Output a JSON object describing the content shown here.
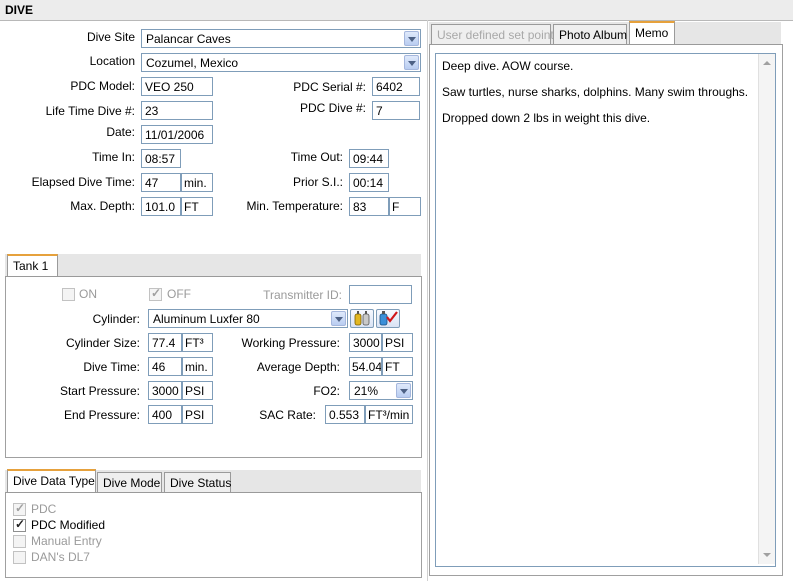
{
  "header": {
    "title": "DIVE"
  },
  "dive": {
    "dive_site": {
      "label": "Dive Site",
      "value": "Palancar Caves"
    },
    "location": {
      "label": "Location",
      "value": "Cozumel, Mexico"
    },
    "pdc_model": {
      "label": "PDC Model:",
      "value": "VEO 250"
    },
    "pdc_serial": {
      "label": "PDC Serial #:",
      "value": "6402"
    },
    "life_time_dive": {
      "label": "Life Time Dive #:",
      "value": "23"
    },
    "pdc_dive": {
      "label": "PDC Dive #:",
      "value": "7"
    },
    "date": {
      "label": "Date:",
      "value": "11/01/2006"
    },
    "time_in": {
      "label": "Time In:",
      "value": "08:57"
    },
    "time_out": {
      "label": "Time Out:",
      "value": "09:44"
    },
    "elapsed": {
      "label": "Elapsed Dive Time:",
      "value": "47",
      "unit": "min."
    },
    "prior_si": {
      "label": "Prior S.I.:",
      "value": "00:14"
    },
    "max_depth": {
      "label": "Max. Depth:",
      "value": "101.0",
      "unit": "FT"
    },
    "min_temp": {
      "label": "Min. Temperature:",
      "value": "83",
      "unit": "F"
    }
  },
  "tank": {
    "tab_label": "Tank 1",
    "on_label": "ON",
    "off_label": "OFF",
    "transmitter": {
      "label": "Transmitter ID:",
      "value": ""
    },
    "cylinder": {
      "label": "Cylinder:",
      "value": "Aluminum Luxfer 80"
    },
    "cylinder_size": {
      "label": "Cylinder Size:",
      "value": "77.4",
      "unit": "FT³"
    },
    "working_pressure": {
      "label": "Working Pressure:",
      "value": "3000",
      "unit": "PSI"
    },
    "dive_time": {
      "label": "Dive Time:",
      "value": "46",
      "unit": "min."
    },
    "average_depth": {
      "label": "Average Depth:",
      "value": "54.04",
      "unit": "FT"
    },
    "start_pressure": {
      "label": "Start Pressure:",
      "value": "3000",
      "unit": "PSI"
    },
    "fo2": {
      "label": "FO2:",
      "value": "21%"
    },
    "end_pressure": {
      "label": "End Pressure:",
      "value": "400",
      "unit": "PSI"
    },
    "sac_rate": {
      "label": "SAC Rate:",
      "value": "0.553",
      "unit": "FT³/min"
    }
  },
  "bottom_tabs": [
    "Dive Data Type",
    "Dive Mode",
    "Dive Status"
  ],
  "data_type": [
    {
      "label": "PDC",
      "checked": true,
      "enabled": false
    },
    {
      "label": "PDC Modified",
      "checked": true,
      "enabled": true
    },
    {
      "label": "Manual Entry",
      "checked": false,
      "enabled": false
    },
    {
      "label": "DAN's DL7",
      "checked": false,
      "enabled": false
    }
  ],
  "right_tabs": [
    "User defined set points",
    "Photo Album",
    "Memo"
  ],
  "memo_lines": [
    "Deep dive. AOW course.",
    "Saw turtles, nurse sharks, dolphins. Many swim throughs.",
    "Dropped down 2 lbs in weight this dive."
  ]
}
